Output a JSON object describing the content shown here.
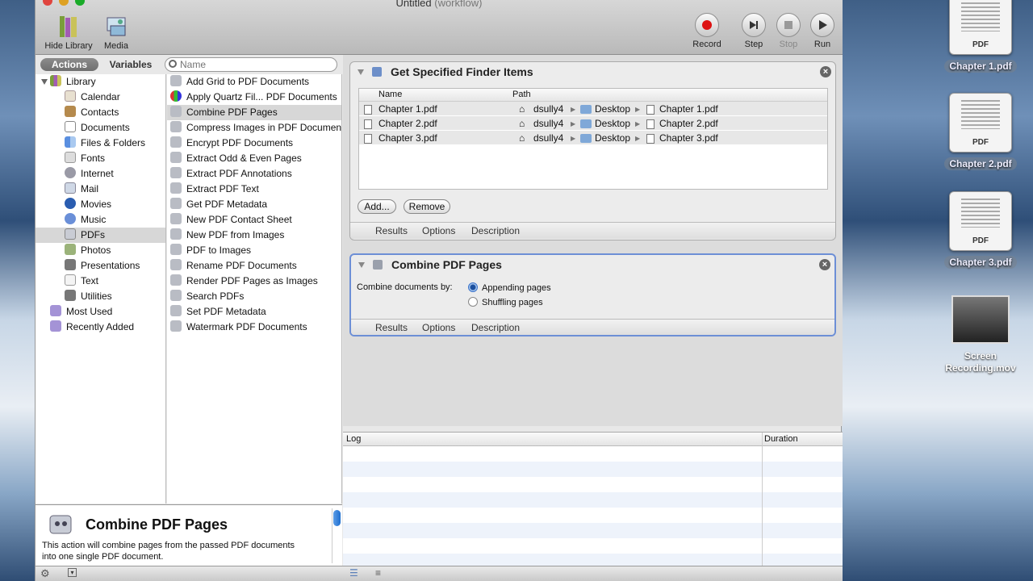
{
  "window": {
    "title": "Untitled",
    "title_suffix": "(workflow)"
  },
  "toolbar": {
    "hide_library": "Hide Library",
    "media": "Media",
    "record": "Record",
    "step": "Step",
    "stop": "Stop",
    "run": "Run"
  },
  "tabs": {
    "actions": "Actions",
    "variables": "Variables"
  },
  "search": {
    "placeholder": "Name"
  },
  "library": {
    "root": "Library",
    "items": [
      "Calendar",
      "Contacts",
      "Documents",
      "Files & Folders",
      "Fonts",
      "Internet",
      "Mail",
      "Movies",
      "Music",
      "PDFs",
      "Photos",
      "Presentations",
      "Text",
      "Utilities"
    ],
    "most_used": "Most Used",
    "recently_added": "Recently Added"
  },
  "actions_list": [
    "Add Grid to PDF Documents",
    "Apply Quartz Fil... PDF Documents",
    "Combine PDF Pages",
    "Compress Images in PDF Documents",
    "Encrypt PDF Documents",
    "Extract Odd & Even Pages",
    "Extract PDF Annotations",
    "Extract PDF Text",
    "Get PDF Metadata",
    "New PDF Contact Sheet",
    "New PDF from Images",
    "PDF to Images",
    "Rename PDF Documents",
    "Render PDF Pages as Images",
    "Search PDFs",
    "Set PDF Metadata",
    "Watermark PDF Documents"
  ],
  "description": {
    "title": "Combine PDF Pages",
    "text": "This action will combine pages from the passed PDF documents into one single PDF document."
  },
  "action1": {
    "title": "Get Specified Finder Items",
    "col_name": "Name",
    "col_path": "Path",
    "rows": [
      {
        "name": "Chapter 1.pdf",
        "user": "dsully4",
        "folder": "Desktop",
        "file": "Chapter 1.pdf"
      },
      {
        "name": "Chapter 2.pdf",
        "user": "dsully4",
        "folder": "Desktop",
        "file": "Chapter 2.pdf"
      },
      {
        "name": "Chapter 3.pdf",
        "user": "dsully4",
        "folder": "Desktop",
        "file": "Chapter 3.pdf"
      }
    ],
    "add": "Add...",
    "remove": "Remove",
    "results": "Results",
    "options": "Options",
    "description": "Description"
  },
  "action2": {
    "title": "Combine PDF Pages",
    "combine_label": "Combine documents by:",
    "opt_append": "Appending pages",
    "opt_shuffle": "Shuffling pages",
    "results": "Results",
    "options": "Options",
    "description": "Description"
  },
  "log": {
    "col_log": "Log",
    "col_duration": "Duration"
  },
  "desktop": {
    "files": [
      {
        "name": "Chapter 1.pdf",
        "label": "PDF"
      },
      {
        "name": "Chapter 2.pdf",
        "label": "PDF"
      },
      {
        "name": "Chapter 3.pdf",
        "label": "PDF"
      }
    ],
    "movie": "Screen Recording.mov"
  }
}
